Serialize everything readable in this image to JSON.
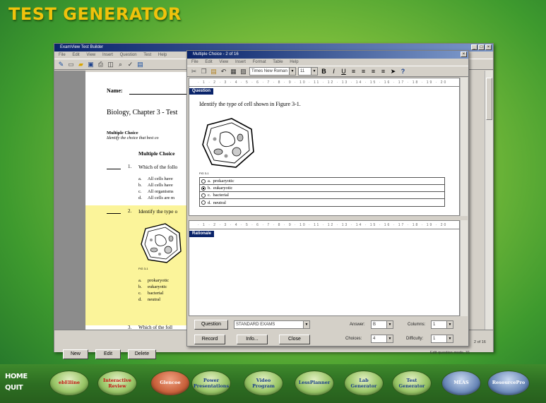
{
  "app_title": "TEST GENERATOR",
  "editor": {
    "title": "ExamView Test Builder",
    "menu": [
      "File",
      "Edit",
      "View",
      "Insert",
      "Question",
      "Test",
      "Help"
    ],
    "doc": {
      "name_label": "Name:",
      "heading": "Biology, Chapter 3 - Test",
      "section_title": "Multiple Choice",
      "section_instr": "Identify the choice that best co",
      "section_center": "Multiple Choice",
      "q1_num": "1.",
      "q1_text": "Which of the follo",
      "q1_choices": [
        {
          "letter": "a.",
          "text": "All cells have"
        },
        {
          "letter": "b.",
          "text": "All cells have"
        },
        {
          "letter": "c.",
          "text": "All organisms"
        },
        {
          "letter": "d.",
          "text": "All cells are m"
        }
      ],
      "q2_num": "2.",
      "q2_text": "Identify the type o",
      "fig_label": "FIG 3-1",
      "q2_choices": [
        {
          "letter": "a.",
          "text": "prokaryotic"
        },
        {
          "letter": "b.",
          "text": "eukaryotic"
        },
        {
          "letter": "c.",
          "text": "bacterial"
        },
        {
          "letter": "d.",
          "text": "neutral"
        }
      ],
      "q3_num": "3.",
      "q3_text": "Which of the foll"
    },
    "buttons": {
      "new": "New",
      "edit": "Edit",
      "delete": "Delete"
    },
    "status": "Edit question mode, 31",
    "page_indicator": "2 of 16"
  },
  "dialog": {
    "title": "Multiple Choice - 2 of 16",
    "menu": [
      "File",
      "Edit",
      "View",
      "Insert",
      "Format",
      "Table",
      "Help"
    ],
    "font_name": "Times New Roman",
    "font_size": "11",
    "question_header": "Question",
    "question_text": "Identify the type of cell shown in Figure 3-1.",
    "fig_label": "FIG 3-1",
    "answers": [
      {
        "letter": "a.",
        "text": "prokaryotic",
        "selected": false
      },
      {
        "letter": "b.",
        "text": "eukaryotic",
        "selected": true
      },
      {
        "letter": "c.",
        "text": "bacterial",
        "selected": false
      },
      {
        "letter": "d.",
        "text": "neutral",
        "selected": false
      }
    ],
    "rationale_header": "Rationale",
    "bottom": {
      "question_btn": "Question",
      "qtype": "STANDARD EXAMS",
      "answer_label": "Answer:",
      "answer_val": "B",
      "choices_label": "Choices:",
      "choices_val": "4",
      "columns_label": "Columns:",
      "columns_val": "1",
      "difficulty_label": "Difficulty:",
      "difficulty_val": "1",
      "record_btn": "Record",
      "info_btn": "Info...",
      "close_btn": "Close"
    }
  },
  "nav": {
    "home": "HOME",
    "quit": "QUIT",
    "buttons": [
      "ebElline",
      "Interactive\nReview",
      "Glencoe",
      "Power\nPresentations",
      "Video\nProgram",
      "LessPlanner",
      "Lab\nGenerator",
      "Test\nGenerator",
      "MLAS",
      "ResourcePro"
    ]
  },
  "colors": {
    "accent_title": "#f0c20c",
    "window_title": "#0a246a",
    "highlight": "#fbf49a"
  }
}
